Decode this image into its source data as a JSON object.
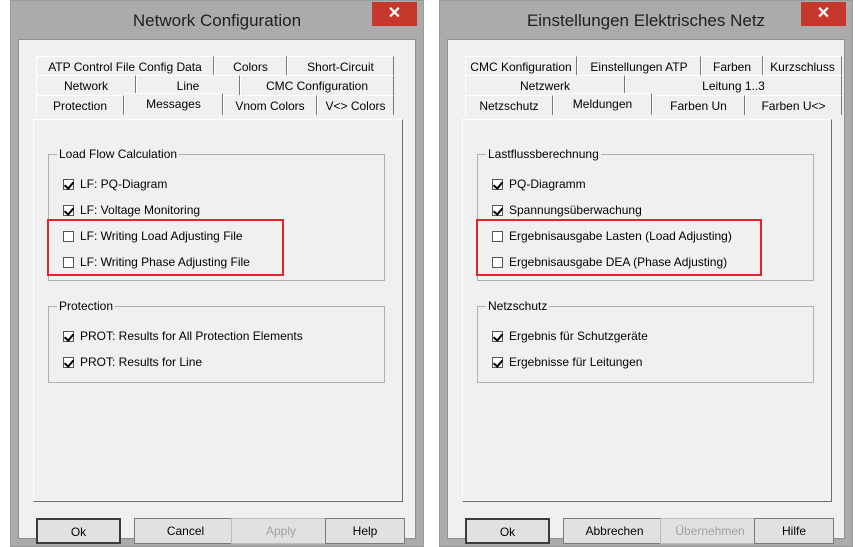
{
  "left": {
    "title": "Network Configuration",
    "close": "✕",
    "tabs_row1": [
      "ATP Control File Config Data",
      "Colors",
      "Short-Circuit"
    ],
    "tabs_row2": [
      "Network",
      "Line",
      "CMC Configuration"
    ],
    "tabs_row3": [
      "Protection",
      "Messages",
      "Vnom Colors",
      "V<> Colors"
    ],
    "group1": {
      "label": "Load Flow Calculation",
      "items": [
        {
          "label": "LF: PQ-Diagram",
          "checked": true
        },
        {
          "label": "LF: Voltage Monitoring",
          "checked": true
        },
        {
          "label": "LF: Writing Load Adjusting File",
          "checked": false
        },
        {
          "label": "LF: Writing Phase Adjusting File",
          "checked": false
        }
      ]
    },
    "group2": {
      "label": "Protection",
      "items": [
        {
          "label": "PROT: Results for All Protection Elements",
          "checked": true
        },
        {
          "label": "PROT: Results for Line",
          "checked": true
        }
      ]
    },
    "buttons": {
      "ok": "Ok",
      "cancel": "Cancel",
      "apply": "Apply",
      "help": "Help"
    }
  },
  "right": {
    "title": "Einstellungen Elektrisches Netz",
    "close": "✕",
    "tabs_row1": [
      "CMC Konfiguration",
      "Einstellungen ATP",
      "Farben",
      "Kurzschluss"
    ],
    "tabs_row2": [
      "Netzwerk",
      "Leitung 1..3"
    ],
    "tabs_row3": [
      "Netzschutz",
      "Meldungen",
      "Farben Un",
      "Farben U<>"
    ],
    "group1": {
      "label": "Lastflussberechnung",
      "items": [
        {
          "label": "PQ-Diagramm",
          "checked": true
        },
        {
          "label": "Spannungsüberwachung",
          "checked": true
        },
        {
          "label": "Ergebnisausgabe Lasten (Load Adjusting)",
          "checked": false
        },
        {
          "label": "Ergebnisausgabe DEA (Phase Adjusting)",
          "checked": false
        }
      ]
    },
    "group2": {
      "label": "Netzschutz",
      "items": [
        {
          "label": "Ergebnis für Schutzgeräte",
          "checked": true
        },
        {
          "label": "Ergebnisse für Leitungen",
          "checked": true
        }
      ]
    },
    "buttons": {
      "ok": "Ok",
      "cancel": "Abbrechen",
      "apply": "Übernehmen",
      "help": "Hilfe"
    }
  },
  "colors": {
    "highlight": "#e0242a",
    "close_button": "#c7382c"
  }
}
